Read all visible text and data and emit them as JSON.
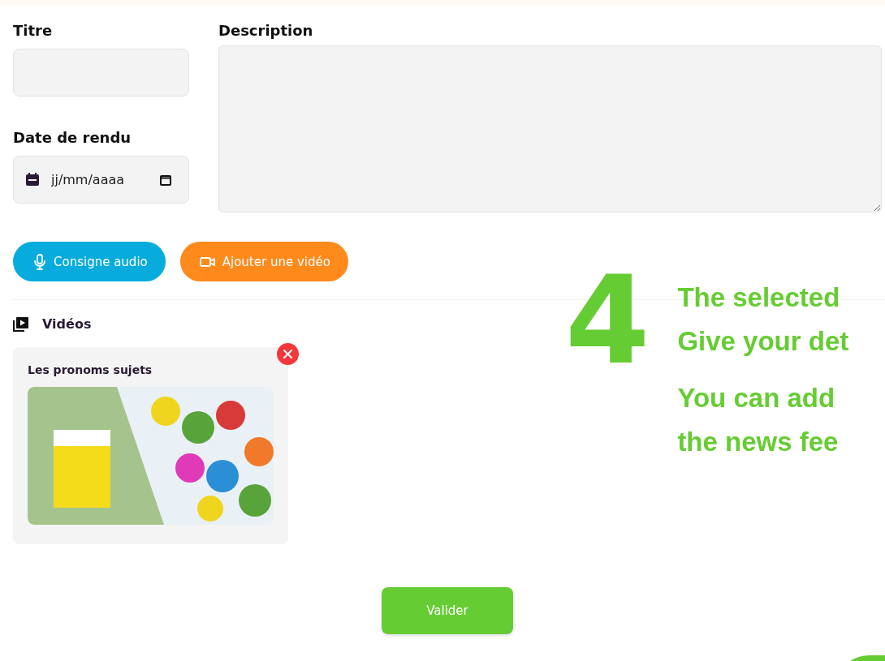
{
  "form": {
    "title_field": {
      "label": "Titre"
    },
    "due_date_field": {
      "label": "Date de rendu",
      "placeholder": "jj/mm/aaaa"
    },
    "description_field": {
      "label": "Description"
    },
    "actions": [
      {
        "kind": "audio",
        "label": "Consigne audio"
      },
      {
        "kind": "video",
        "label": "Ajouter une vidéo"
      }
    ]
  },
  "videos": {
    "heading": "Vidéos",
    "items": [
      {
        "title": "Les pronoms sujets"
      }
    ]
  },
  "submit": "Valider",
  "tutorial_overlay": {
    "step": "4",
    "paragraphs": [
      [
        "The selected",
        "Give your det"
      ],
      [
        "You can add",
        "the news fee"
      ]
    ]
  }
}
